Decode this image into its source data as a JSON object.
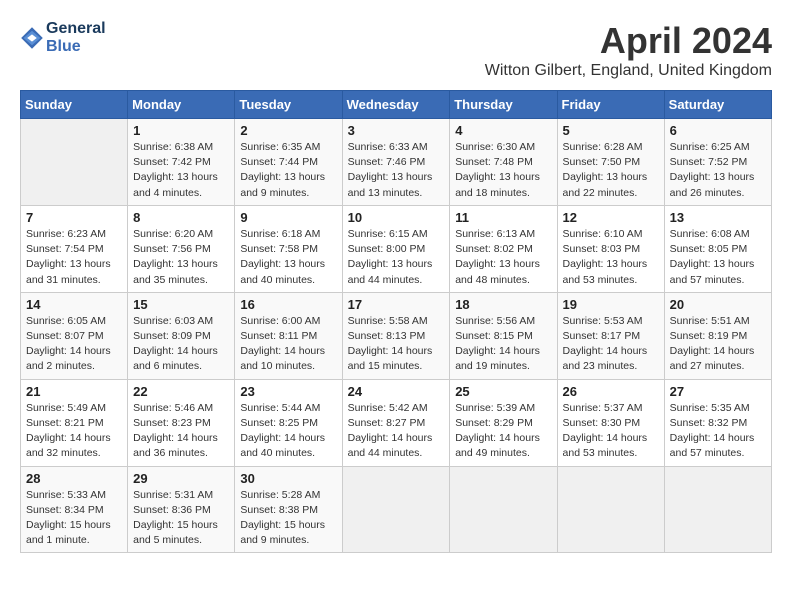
{
  "header": {
    "logo_line1": "General",
    "logo_line2": "Blue",
    "month": "April 2024",
    "location": "Witton Gilbert, England, United Kingdom"
  },
  "days_of_week": [
    "Sunday",
    "Monday",
    "Tuesday",
    "Wednesday",
    "Thursday",
    "Friday",
    "Saturday"
  ],
  "weeks": [
    [
      {
        "num": "",
        "info": ""
      },
      {
        "num": "1",
        "info": "Sunrise: 6:38 AM\nSunset: 7:42 PM\nDaylight: 13 hours\nand 4 minutes."
      },
      {
        "num": "2",
        "info": "Sunrise: 6:35 AM\nSunset: 7:44 PM\nDaylight: 13 hours\nand 9 minutes."
      },
      {
        "num": "3",
        "info": "Sunrise: 6:33 AM\nSunset: 7:46 PM\nDaylight: 13 hours\nand 13 minutes."
      },
      {
        "num": "4",
        "info": "Sunrise: 6:30 AM\nSunset: 7:48 PM\nDaylight: 13 hours\nand 18 minutes."
      },
      {
        "num": "5",
        "info": "Sunrise: 6:28 AM\nSunset: 7:50 PM\nDaylight: 13 hours\nand 22 minutes."
      },
      {
        "num": "6",
        "info": "Sunrise: 6:25 AM\nSunset: 7:52 PM\nDaylight: 13 hours\nand 26 minutes."
      }
    ],
    [
      {
        "num": "7",
        "info": "Sunrise: 6:23 AM\nSunset: 7:54 PM\nDaylight: 13 hours\nand 31 minutes."
      },
      {
        "num": "8",
        "info": "Sunrise: 6:20 AM\nSunset: 7:56 PM\nDaylight: 13 hours\nand 35 minutes."
      },
      {
        "num": "9",
        "info": "Sunrise: 6:18 AM\nSunset: 7:58 PM\nDaylight: 13 hours\nand 40 minutes."
      },
      {
        "num": "10",
        "info": "Sunrise: 6:15 AM\nSunset: 8:00 PM\nDaylight: 13 hours\nand 44 minutes."
      },
      {
        "num": "11",
        "info": "Sunrise: 6:13 AM\nSunset: 8:02 PM\nDaylight: 13 hours\nand 48 minutes."
      },
      {
        "num": "12",
        "info": "Sunrise: 6:10 AM\nSunset: 8:03 PM\nDaylight: 13 hours\nand 53 minutes."
      },
      {
        "num": "13",
        "info": "Sunrise: 6:08 AM\nSunset: 8:05 PM\nDaylight: 13 hours\nand 57 minutes."
      }
    ],
    [
      {
        "num": "14",
        "info": "Sunrise: 6:05 AM\nSunset: 8:07 PM\nDaylight: 14 hours\nand 2 minutes."
      },
      {
        "num": "15",
        "info": "Sunrise: 6:03 AM\nSunset: 8:09 PM\nDaylight: 14 hours\nand 6 minutes."
      },
      {
        "num": "16",
        "info": "Sunrise: 6:00 AM\nSunset: 8:11 PM\nDaylight: 14 hours\nand 10 minutes."
      },
      {
        "num": "17",
        "info": "Sunrise: 5:58 AM\nSunset: 8:13 PM\nDaylight: 14 hours\nand 15 minutes."
      },
      {
        "num": "18",
        "info": "Sunrise: 5:56 AM\nSunset: 8:15 PM\nDaylight: 14 hours\nand 19 minutes."
      },
      {
        "num": "19",
        "info": "Sunrise: 5:53 AM\nSunset: 8:17 PM\nDaylight: 14 hours\nand 23 minutes."
      },
      {
        "num": "20",
        "info": "Sunrise: 5:51 AM\nSunset: 8:19 PM\nDaylight: 14 hours\nand 27 minutes."
      }
    ],
    [
      {
        "num": "21",
        "info": "Sunrise: 5:49 AM\nSunset: 8:21 PM\nDaylight: 14 hours\nand 32 minutes."
      },
      {
        "num": "22",
        "info": "Sunrise: 5:46 AM\nSunset: 8:23 PM\nDaylight: 14 hours\nand 36 minutes."
      },
      {
        "num": "23",
        "info": "Sunrise: 5:44 AM\nSunset: 8:25 PM\nDaylight: 14 hours\nand 40 minutes."
      },
      {
        "num": "24",
        "info": "Sunrise: 5:42 AM\nSunset: 8:27 PM\nDaylight: 14 hours\nand 44 minutes."
      },
      {
        "num": "25",
        "info": "Sunrise: 5:39 AM\nSunset: 8:29 PM\nDaylight: 14 hours\nand 49 minutes."
      },
      {
        "num": "26",
        "info": "Sunrise: 5:37 AM\nSunset: 8:30 PM\nDaylight: 14 hours\nand 53 minutes."
      },
      {
        "num": "27",
        "info": "Sunrise: 5:35 AM\nSunset: 8:32 PM\nDaylight: 14 hours\nand 57 minutes."
      }
    ],
    [
      {
        "num": "28",
        "info": "Sunrise: 5:33 AM\nSunset: 8:34 PM\nDaylight: 15 hours\nand 1 minute."
      },
      {
        "num": "29",
        "info": "Sunrise: 5:31 AM\nSunset: 8:36 PM\nDaylight: 15 hours\nand 5 minutes."
      },
      {
        "num": "30",
        "info": "Sunrise: 5:28 AM\nSunset: 8:38 PM\nDaylight: 15 hours\nand 9 minutes."
      },
      {
        "num": "",
        "info": ""
      },
      {
        "num": "",
        "info": ""
      },
      {
        "num": "",
        "info": ""
      },
      {
        "num": "",
        "info": ""
      }
    ]
  ]
}
